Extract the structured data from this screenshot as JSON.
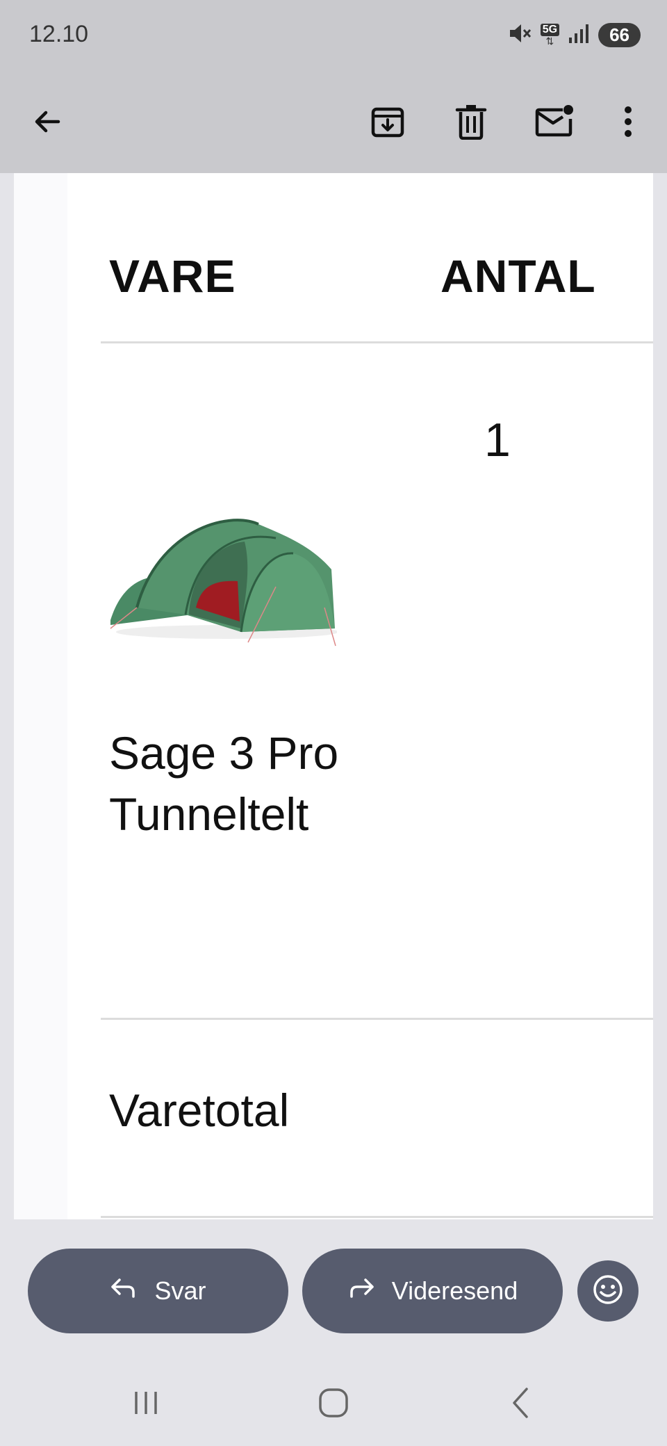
{
  "status_bar": {
    "time": "12.10",
    "network_label": "5G",
    "battery_level": "66"
  },
  "toolbar": {
    "back_icon": "arrow-left-icon",
    "archive_icon": "archive-icon",
    "delete_icon": "trash-icon",
    "mark_unread_icon": "mail-unread-icon",
    "more_icon": "more-vertical-icon"
  },
  "order_table": {
    "header_item": "VARE",
    "header_quantity": "ANTAL",
    "items": [
      {
        "name": "Sage 3 Pro Tunneltelt",
        "quantity": "1",
        "image": "green tent"
      }
    ],
    "subtotal_label": "Varetotal"
  },
  "actions": {
    "reply_label": "Svar",
    "forward_label": "Videresend",
    "emoji_icon": "emoji-icon"
  },
  "colors": {
    "bar_gray": "#c9c9cd",
    "action_button": "#575c6e",
    "tent_green": "#4e8c68",
    "tent_inner": "#9c1c22"
  }
}
